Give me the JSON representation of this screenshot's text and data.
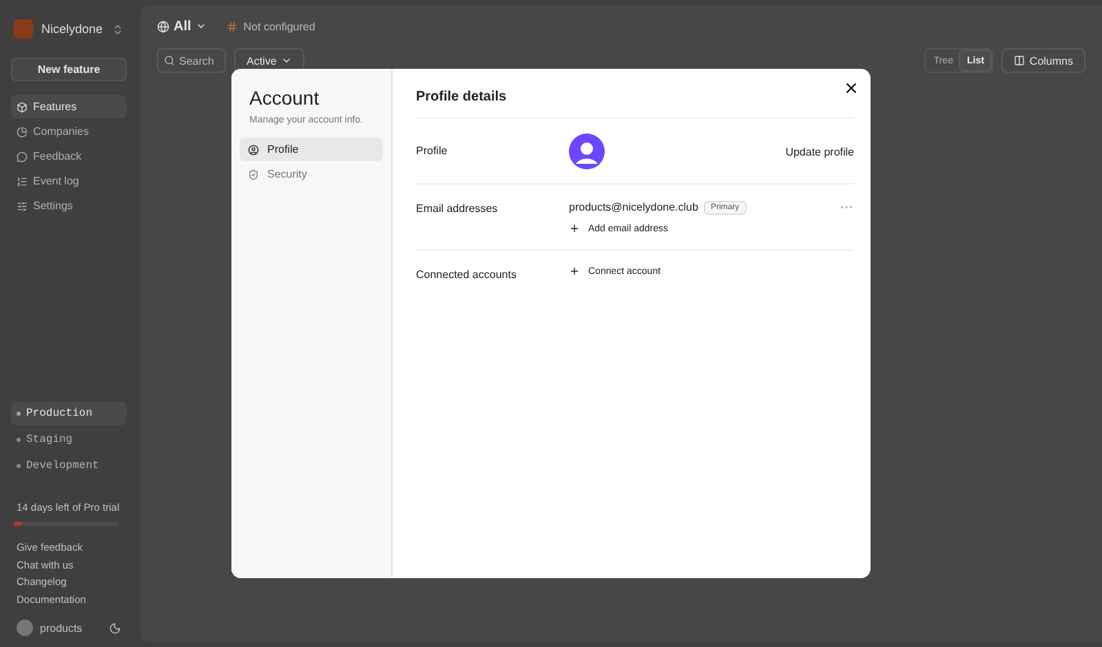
{
  "sidebar": {
    "workspace": "Nicelydone",
    "new_button": "New feature",
    "nav": [
      {
        "label": "Features",
        "selected": true
      },
      {
        "label": "Companies",
        "selected": false
      },
      {
        "label": "Feedback",
        "selected": false
      },
      {
        "label": "Event log",
        "selected": false
      },
      {
        "label": "Settings",
        "selected": false
      }
    ],
    "environments": [
      {
        "label": "Production",
        "selected": true
      },
      {
        "label": "Staging",
        "selected": false
      },
      {
        "label": "Development",
        "selected": false
      }
    ],
    "trial": {
      "text": "14 days left of Pro trial",
      "level": 0.08
    },
    "links": [
      "Give feedback",
      "Chat with us",
      "Changelog",
      "Documentation"
    ],
    "user": "products"
  },
  "toolbar": {
    "scope": "All",
    "status": "Not configured",
    "search": {
      "placeholder": "Search"
    },
    "filter": "Active",
    "views": [
      {
        "label": "Tree",
        "selected": false
      },
      {
        "label": "List",
        "selected": true
      }
    ],
    "columns_button": "Columns"
  },
  "modal": {
    "title": "Account",
    "subtitle": "Manage your account info.",
    "tabs": [
      {
        "label": "Profile",
        "selected": true
      },
      {
        "label": "Security",
        "selected": false
      }
    ],
    "heading": "Profile details",
    "profile": {
      "label": "Profile",
      "action": "Update profile"
    },
    "emails": {
      "label": "Email addresses",
      "address": "products@nicelydone.club",
      "badge": "Primary",
      "add": "Add email address"
    },
    "connected": {
      "label": "Connected accounts",
      "add": "Connect account"
    }
  }
}
